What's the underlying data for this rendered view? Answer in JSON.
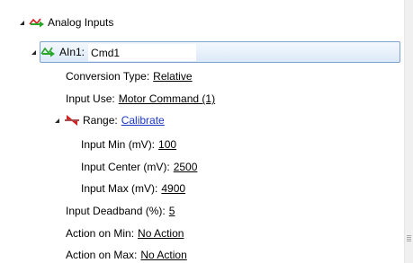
{
  "tree": {
    "root": {
      "label": "Analog Inputs",
      "icon": "green-red-arrows-icon"
    },
    "ain1": {
      "label": "AIn1:",
      "edit_value": "Cmd1",
      "icon": "green-arrow-icon"
    },
    "conversion_type": {
      "label": "Conversion Type:",
      "value": "Relative"
    },
    "input_use": {
      "label": "Input Use:",
      "value": "Motor Command (1)"
    },
    "range": {
      "label": "Range:",
      "value": "Calibrate",
      "icon": "red-arrows-icon"
    },
    "input_min": {
      "label": "Input Min (mV):",
      "value": "100"
    },
    "input_center": {
      "label": "Input Center (mV):",
      "value": "2500"
    },
    "input_max": {
      "label": "Input Max (mV):",
      "value": "4900"
    },
    "input_deadband": {
      "label": "Input Deadband (%):",
      "value": "5"
    },
    "action_on_min": {
      "label": "Action on Min:",
      "value": "No Action"
    },
    "action_on_max": {
      "label": "Action on Max:",
      "value": "No Action"
    }
  },
  "colors": {
    "link": "#1a35c4",
    "selection_border": "#7da2ce",
    "icon_green": "#2aa62a",
    "icon_red": "#d42020"
  }
}
